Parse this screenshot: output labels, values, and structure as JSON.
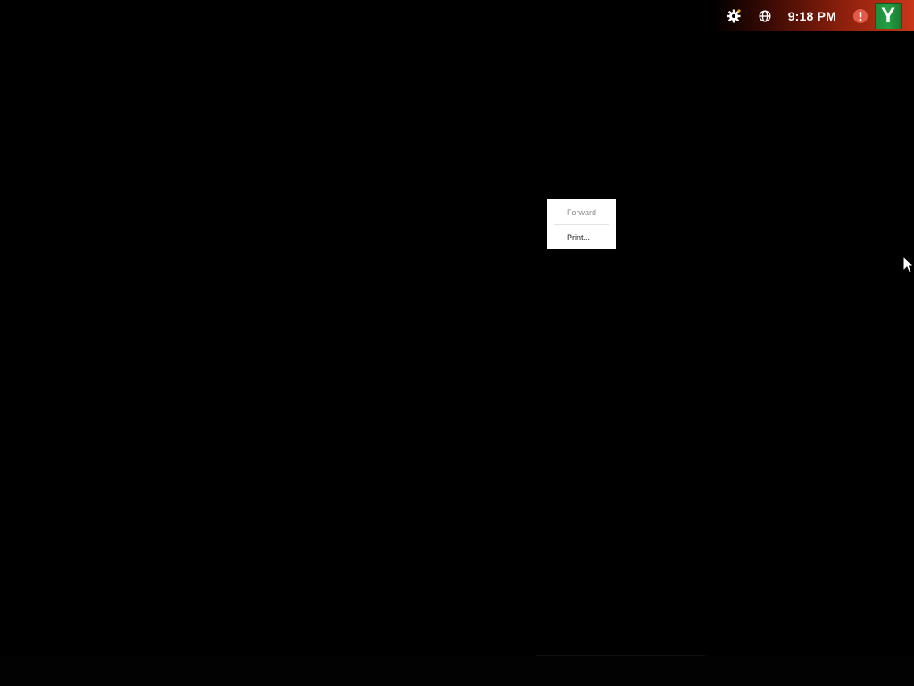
{
  "tray": {
    "settings_icon": "gear-icon",
    "network_icon": "globe-icon",
    "clock_text": "9:18 PM",
    "alert_icon": "exclamation-circle-icon",
    "alert_color": "#e25a48",
    "avatar_letter": "Y",
    "avatar_color": "#22a244",
    "top_bar_accent": "#c8361a"
  },
  "context_menu": {
    "items": [
      {
        "label": "Forward",
        "enabled": false
      },
      {
        "label": "Print...",
        "enabled": true
      }
    ]
  },
  "desktop": {
    "background": "#000000"
  }
}
